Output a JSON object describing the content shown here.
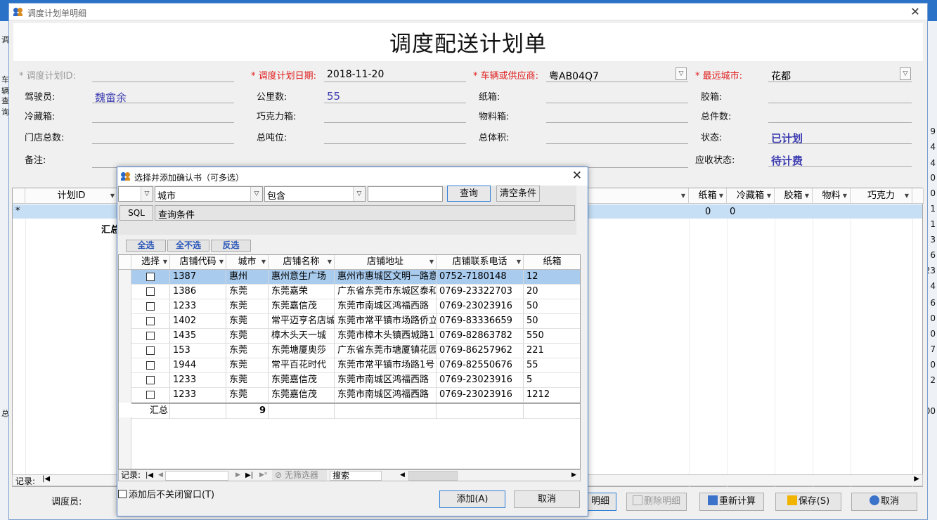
{
  "background": {
    "left_labels": [
      "调",
      "车辆",
      "查询",
      "总"
    ],
    "right_numbers": [
      "9",
      "4",
      "4",
      "0",
      "0",
      "1",
      "1",
      "3",
      "6",
      "23",
      "4",
      "6",
      "0",
      "0",
      "7",
      "0",
      "2",
      "00"
    ]
  },
  "main": {
    "window_title": "调度计划单明细",
    "close": "✕",
    "big_title": "调度配送计划单",
    "form": {
      "plan_id_label": "* 调度计划ID:",
      "plan_id_value": "",
      "plan_date_label": "* 调度计划日期:",
      "plan_date_value": "2018-11-20",
      "vehicle_label": "* 车辆或供应商:",
      "vehicle_value": "粤AB04Q7",
      "farthest_city_label": "* 最远城市:",
      "farthest_city_value": "花都",
      "driver_label": "驾驶员:",
      "driver_value": "魏畲余",
      "km_label": "公里数:",
      "km_value": "55",
      "paper_box_label": "纸箱:",
      "paper_box_value": "",
      "rubber_box_label": "胶箱:",
      "rubber_box_value": "",
      "cold_box_label": "冷藏箱:",
      "cold_box_value": "",
      "chocolate_box_label": "巧克力箱:",
      "chocolate_box_value": "",
      "material_box_label": "物料箱:",
      "material_box_value": "",
      "total_pieces_label": "总件数:",
      "total_pieces_value": "",
      "store_count_label": "门店总数:",
      "store_count_value": "",
      "total_tonnage_label": "总吨位:",
      "total_tonnage_value": "",
      "total_volume_label": "总体积:",
      "total_volume_value": "",
      "status_label": "状态:",
      "status_value": "已计划",
      "remark_label": "备注:",
      "remark_value": "",
      "receivable_label": "应收状态:",
      "receivable_value": "待计费"
    },
    "grid": {
      "headers": [
        "计划ID",
        "纸箱",
        "冷藏箱",
        "胶箱",
        "物料",
        "巧克力"
      ],
      "new_row_marker": "*",
      "row_values": [
        "0",
        "0"
      ],
      "summary_label": "汇总"
    },
    "nav_label": "记录:",
    "dispatcher_label": "调度员:",
    "buttons": {
      "detail": "明细",
      "delete_detail": "删除明细",
      "recalc": "重新计算",
      "save": "保存(S)",
      "cancel": "取消"
    }
  },
  "dialog": {
    "title": "选择并添加确认书（可多选）",
    "close": "✕",
    "filter": {
      "field_value": "城市",
      "op_value": "包含",
      "text_value": "",
      "query_button": "查询",
      "clear_button": "清空条件",
      "sql_tag": "SQL",
      "sql_text": "查询条件"
    },
    "select_all": "全选",
    "select_none": "全不选",
    "invert": "反选",
    "columns": [
      "选择",
      "店铺代码",
      "城市",
      "店铺名称",
      "店铺地址",
      "店铺联系电话",
      "纸箱"
    ],
    "rows": [
      {
        "code": "1387",
        "city": "惠州",
        "name": "惠州意生广场",
        "address": "惠州市惠城区文明一路意",
        "phone": "0752-7180148",
        "paper": "12"
      },
      {
        "code": "1386",
        "city": "东莞",
        "name": "东莞嘉荣",
        "address": "广东省东莞市东城区泰和",
        "phone": "0769-23322703",
        "paper": "20"
      },
      {
        "code": "1233",
        "city": "东莞",
        "name": "东莞嘉信茂",
        "address": "东莞市南城区鸿福西路",
        "phone": "0769-23023916",
        "paper": "50"
      },
      {
        "code": "1402",
        "city": "东莞",
        "name": "常平迈亨名店城",
        "address": "东莞市常平镇市场路侨立",
        "phone": "0769-83336659",
        "paper": "50"
      },
      {
        "code": "1435",
        "city": "东莞",
        "name": "樟木头天一城",
        "address": "东莞市樟木头镇西城路1",
        "phone": "0769-82863782",
        "paper": "550"
      },
      {
        "code": "153",
        "city": "东莞",
        "name": "东莞塘厦奥莎",
        "address": "广东省东莞市塘厦镇花园",
        "phone": "0769-86257962",
        "paper": "221"
      },
      {
        "code": "1944",
        "city": "东莞",
        "name": "常平百花时代",
        "address": "东莞市常平镇市场路1号",
        "phone": "0769-82550676",
        "paper": "55"
      },
      {
        "code": "1233",
        "city": "东莞",
        "name": "东莞嘉信茂",
        "address": "东莞市南城区鸿福西路",
        "phone": "0769-23023916",
        "paper": "5"
      },
      {
        "code": "1233",
        "city": "东莞",
        "name": "东莞嘉信茂",
        "address": "东莞市南城区鸿福西路",
        "phone": "0769-23023916",
        "paper": "1212"
      }
    ],
    "summary_label": "汇总",
    "summary_count": "9",
    "nav_label": "记录:",
    "no_filter": "无筛选器",
    "search_label": "搜索",
    "keep_open_label": "添加后不关闭窗口(T)",
    "add_button": "添加(A)",
    "cancel_button": "取消"
  }
}
